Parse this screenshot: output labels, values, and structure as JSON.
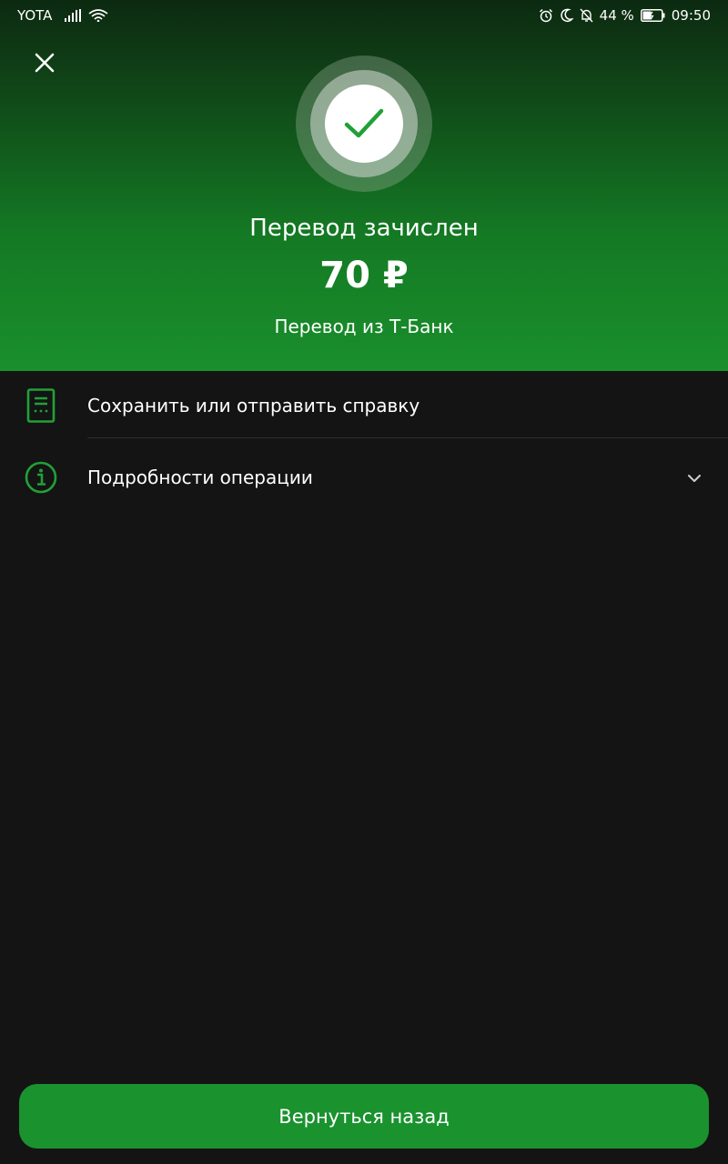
{
  "status_bar": {
    "carrier": "YOTA",
    "battery_percent": "44 %",
    "time": "09:50",
    "icons": [
      "signal-icon",
      "wifi-icon",
      "alarm-icon",
      "moon-icon",
      "bell-off-icon",
      "battery-icon"
    ]
  },
  "header": {
    "close_icon": "close-icon",
    "status_icon": "check-icon",
    "title": "Перевод зачислен",
    "amount": "70 ₽",
    "subtitle": "Перевод из Т-Банк"
  },
  "actions": [
    {
      "icon": "receipt-icon",
      "label": "Сохранить или отправить справку"
    },
    {
      "icon": "info-icon",
      "label": "Подробности операции",
      "expand_icon": "chevron-down-icon"
    }
  ],
  "footer": {
    "back_label": "Вернуться назад"
  },
  "colors": {
    "accent": "#1a922e",
    "background": "#141414",
    "icon_green": "#21a038",
    "header_top": "#0c2a11",
    "header_bottom": "#1a8f2c"
  }
}
